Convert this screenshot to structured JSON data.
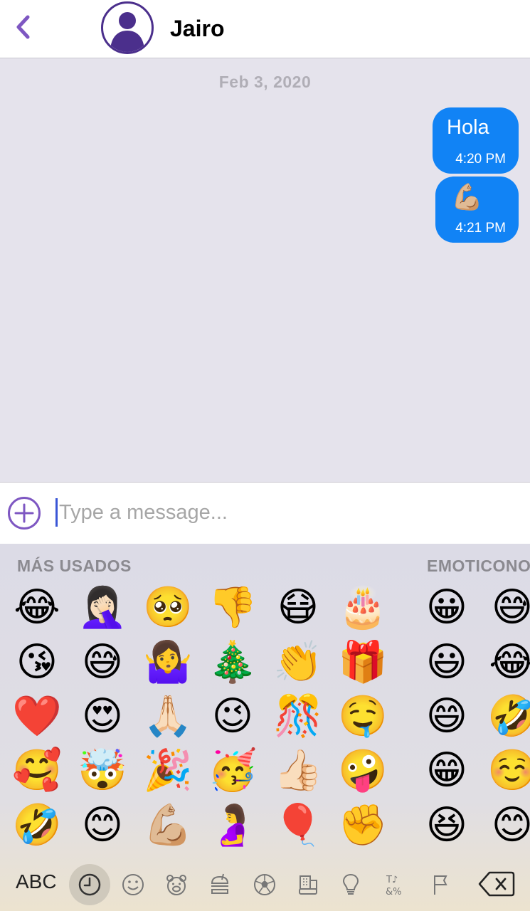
{
  "header": {
    "contact_name": "Jairo"
  },
  "chat": {
    "date_separator": "Feb 3, 2020",
    "messages": [
      {
        "text": "Hola",
        "time": "4:20 PM"
      },
      {
        "emoji": "💪🏼",
        "time": "4:21 PM"
      }
    ]
  },
  "composer": {
    "placeholder": "Type a message..."
  },
  "keyboard": {
    "section_frequent": "MÁS USADOS",
    "section_emoticons": "EMOTICONO",
    "frequent_emojis": [
      [
        "😂",
        "🤦🏻‍♀️",
        "🥺",
        "👎",
        "😷",
        "🎂"
      ],
      [
        "😘",
        "😅",
        "🤷‍♀️",
        "🎄",
        "👏",
        "🎁"
      ],
      [
        "❤️",
        "😍",
        "🙏🏻",
        "😉",
        "🎊",
        "🤤"
      ],
      [
        "🥰",
        "🤯",
        "🎉",
        "🥳",
        "👍🏻",
        "🤪"
      ],
      [
        "🤣",
        "😊",
        "💪🏼",
        "🤰",
        "🎈",
        "✊"
      ]
    ],
    "emoticon_emojis": [
      [
        "😀",
        "😅"
      ],
      [
        "😃",
        "😂"
      ],
      [
        "😄",
        "🤣"
      ],
      [
        "😁",
        "☺️"
      ],
      [
        "😆",
        "😊"
      ]
    ],
    "abc_label": "ABC",
    "categories": [
      {
        "name": "recent-icon"
      },
      {
        "name": "smileys-icon"
      },
      {
        "name": "animals-icon"
      },
      {
        "name": "food-icon"
      },
      {
        "name": "activity-icon"
      },
      {
        "name": "travel-icon"
      },
      {
        "name": "objects-icon"
      },
      {
        "name": "symbols-icon"
      },
      {
        "name": "flags-icon"
      }
    ]
  },
  "colors": {
    "accent": "#7e57c2",
    "bubble": "#1183f5",
    "chat_background": "#e5e3ec"
  }
}
